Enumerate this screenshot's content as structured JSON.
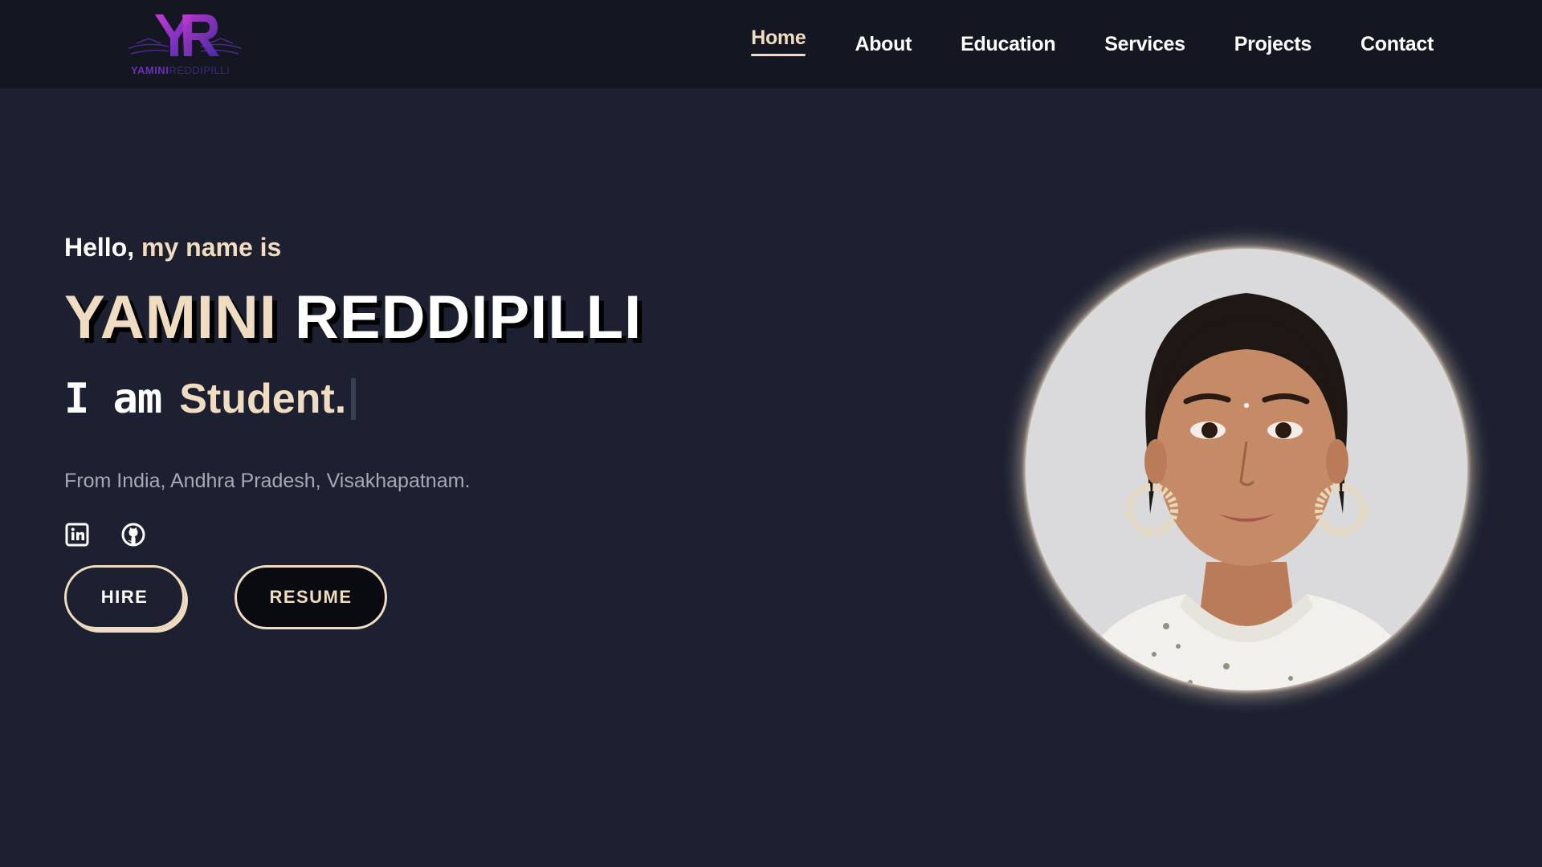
{
  "brand": {
    "logo_name": "yr-monogram-logo",
    "logo_text_part1": "YAMINI",
    "logo_text_part2": "REDDIPILLI"
  },
  "nav": {
    "items": [
      {
        "label": "Home",
        "active": true
      },
      {
        "label": "About",
        "active": false
      },
      {
        "label": "Education",
        "active": false
      },
      {
        "label": "Services",
        "active": false
      },
      {
        "label": "Projects",
        "active": false
      },
      {
        "label": "Contact",
        "active": false
      }
    ]
  },
  "hero": {
    "greeting_prefix": "Hello,",
    "greeting_accent": "my name is",
    "first_name": "YAMINI",
    "last_name": "REDDIPILLI",
    "role_prefix": "I am",
    "role_word": "Student.",
    "location": "From India, Andhra Pradesh, Visakhapatnam.",
    "socials": [
      {
        "icon": "linkedin-icon"
      },
      {
        "icon": "github-icon"
      }
    ],
    "buttons": {
      "hire": "HIRE",
      "resume": "RESUME"
    }
  },
  "colors": {
    "background": "#1c2030",
    "navbar": "#141721",
    "accent": "#f0dcc0",
    "muted_text": "#a6a9b3"
  }
}
